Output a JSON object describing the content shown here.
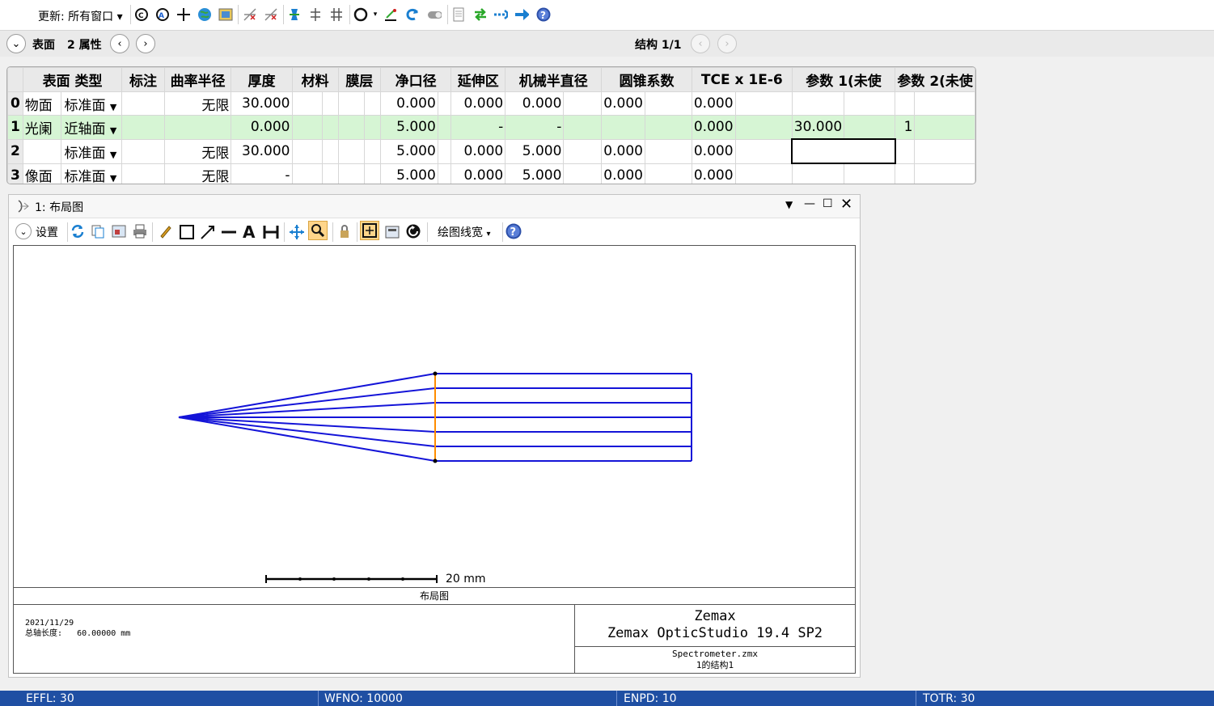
{
  "toolbar": {
    "update_label": "更新: 所有窗口",
    "icons": [
      "refresh-all-icon",
      "refresh-icon",
      "crosshair-icon",
      "globe-icon",
      "image-icon",
      "x-axis-icon",
      "x-axis-alt-icon",
      "lens-icon",
      "split-icon",
      "split-alt-icon",
      "circle-icon",
      "wand-icon",
      "undo-icon",
      "toggle-icon",
      "page-icon",
      "swap-icon",
      "dots-arrow-icon",
      "arrow-right-icon",
      "help-icon"
    ]
  },
  "surface_bar": {
    "surface_label": "表面",
    "props_label": "2 属性",
    "config_label": "结构 1/1"
  },
  "lde": {
    "columns": [
      "表面 类型",
      "标注",
      "曲率半径",
      "厚度",
      "材料",
      "膜层",
      "净口径",
      "延伸区",
      "机械半直径",
      "圆锥系数",
      "TCE x 1E-6",
      "参数 1(未使",
      "参数 2(未使"
    ],
    "rows": [
      {
        "num": "0",
        "name": "物面",
        "type": "标准面",
        "comment": "",
        "radius": "无限",
        "thickness": "30.000",
        "material": "",
        "coating": "",
        "clear": "0.000",
        "chip": "0.000",
        "mech": "0.000",
        "conic": "0.000",
        "tce": "0.000",
        "p1": "",
        "p2": ""
      },
      {
        "num": "1",
        "name": "光阑",
        "type": "近轴面",
        "comment": "",
        "radius": "",
        "thickness": "0.000",
        "material": "",
        "coating": "",
        "clear": "5.000",
        "chip": "-",
        "mech": "-",
        "conic": "",
        "tce": "0.000",
        "p1": "30.000",
        "p2": "1"
      },
      {
        "num": "2",
        "name": "",
        "type": "标准面",
        "comment": "",
        "radius": "无限",
        "thickness": "30.000",
        "material": "",
        "coating": "",
        "clear": "5.000",
        "chip": "0.000",
        "mech": "5.000",
        "conic": "0.000",
        "tce": "0.000",
        "p1": "",
        "p2": ""
      },
      {
        "num": "3",
        "name": "像面",
        "type": "标准面",
        "comment": "",
        "radius": "无限",
        "thickness": "-",
        "material": "",
        "coating": "",
        "clear": "5.000",
        "chip": "0.000",
        "mech": "5.000",
        "conic": "0.000",
        "tce": "0.000",
        "p1": "",
        "p2": ""
      }
    ]
  },
  "layout_window": {
    "title": "1: 布局图",
    "settings_label": "设置",
    "linewidth_label": "绘图线宽",
    "scale_label": "20 mm",
    "caption": "布局图",
    "date": "2021/11/29",
    "total_length_label": "总轴长度:",
    "total_length_value": "60.00000 mm",
    "brand": "Zemax",
    "product": "Zemax OpticStudio 19.4 SP2",
    "file": "Spectrometer.zmx",
    "config": "1的结构1",
    "ray_color": "#1414d8",
    "stop_color": "#ff8c00"
  },
  "status": {
    "effl": "EFFL: 30",
    "wfno": "WFNO: 10000",
    "enpd": "ENPD: 10",
    "totr": "TOTR: 30"
  }
}
